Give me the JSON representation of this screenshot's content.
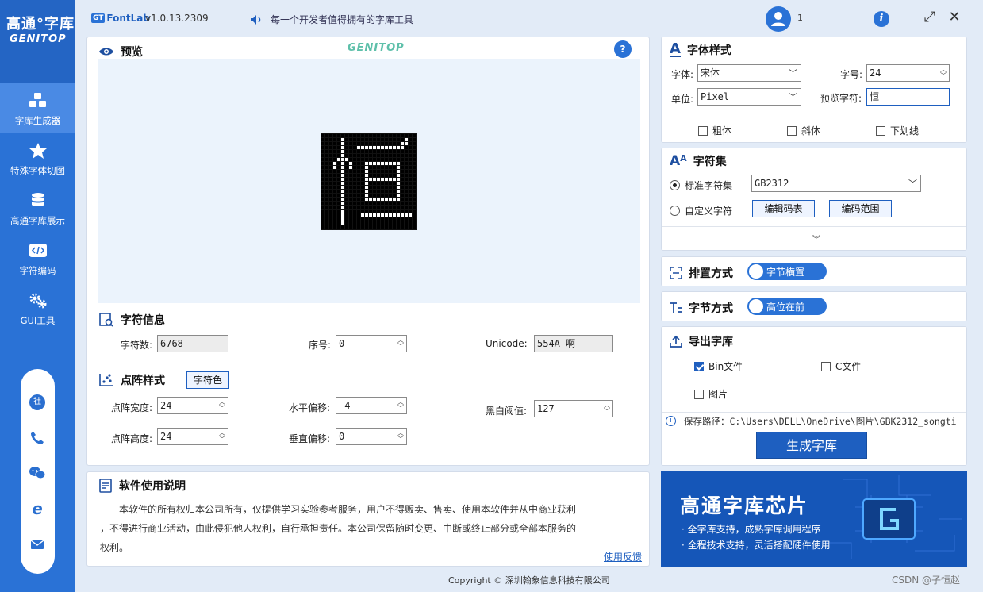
{
  "sidebar": {
    "logo_title": "高通°字库",
    "logo_sub": "GENITOP",
    "items": [
      {
        "label": "字库生成器",
        "icon": "cubes-icon"
      },
      {
        "label": "特殊字体切图",
        "icon": "star-icon"
      },
      {
        "label": "高通字库展示",
        "icon": "database-icon"
      },
      {
        "label": "字符编码",
        "icon": "code-icon"
      },
      {
        "label": "GUI工具",
        "icon": "gears-icon"
      }
    ],
    "contact_badge": "社"
  },
  "topbar": {
    "app_badge": "GT",
    "app_name": "FontLab",
    "version": "v1.0.13.2309",
    "slogan": "每一个开发者值得拥有的字库工具",
    "user_name": "1"
  },
  "preview": {
    "title": "预览",
    "watermark": "GENITOP",
    "help": "?"
  },
  "char_info": {
    "title": "字符信息",
    "count_label": "字符数:",
    "count_value": "6768",
    "index_label": "序号:",
    "index_value": "0",
    "unicode_label": "Unicode:",
    "unicode_value": "554A 啊"
  },
  "dot_style": {
    "title": "点阵样式",
    "color_btn": "字符色",
    "width_label": "点阵宽度:",
    "width_value": "24",
    "height_label": "点阵高度:",
    "height_value": "24",
    "hoffset_label": "水平偏移:",
    "hoffset_value": "-4",
    "voffset_label": "垂直偏移:",
    "voffset_value": "0",
    "threshold_label": "黑白阈值:",
    "threshold_value": "127"
  },
  "manual": {
    "title": "软件使用说明",
    "line1": "本软件的所有权归本公司所有，仅提供学习实验参考服务，用户不得贩卖、售卖、使用本软件并从中商业获利",
    "line2": "，不得进行商业活动，由此侵犯他人权利，自行承担责任。本公司保留随时变更、中断或终止部分或全部本服务的",
    "line3": "权利。",
    "feedback": "使用反馈"
  },
  "font_style": {
    "title": "字体样式",
    "font_label": "字体:",
    "font_value": "宋体",
    "size_label": "字号:",
    "size_value": "24",
    "unit_label": "单位:",
    "unit_value": "Pixel",
    "preview_char_label": "预览字符:",
    "preview_char_value": "恒",
    "bold": "粗体",
    "italic": "斜体",
    "underline": "下划线"
  },
  "charset": {
    "title": "字符集",
    "standard_label": "标准字符集",
    "standard_value": "GB2312",
    "custom_label": "自定义字符",
    "edit_table_btn": "编辑码表",
    "edit_range_btn": "编码范围"
  },
  "arrange": {
    "title": "排置方式",
    "toggle": "字节横置"
  },
  "byte_order": {
    "title": "字节方式",
    "toggle": "高位在前"
  },
  "export": {
    "title": "导出字库",
    "bin": "Bin文件",
    "bin_checked": true,
    "c": "C文件",
    "image": "图片",
    "path": "保存路径：C:\\Users\\DELL\\OneDrive\\图片\\GBK2312_songti",
    "generate": "生成字库"
  },
  "banner": {
    "title": "高通字库芯片",
    "line1": "· 全字库支持，成熟字库调用程序",
    "line2": "· 全程技术支持，灵活搭配硬件使用"
  },
  "footer": {
    "copyright": "Copyright ©  深圳翰象信息科技有限公司",
    "csdn": "CSDN @子恒赵"
  },
  "colors": {
    "sidebar": "#2a72d6",
    "accent": "#1e5fc0",
    "preview_bg": "#ebf3fc"
  }
}
